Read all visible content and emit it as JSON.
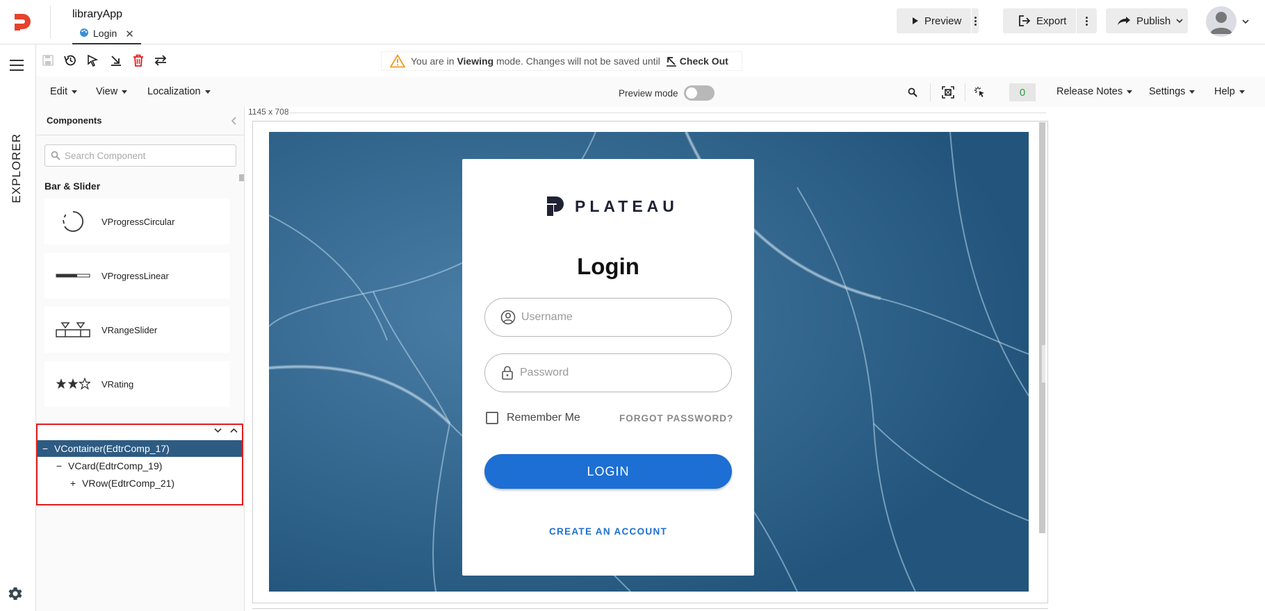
{
  "header": {
    "app_title": "libraryApp",
    "file_tab": {
      "label": "Login",
      "icon": "palette-icon"
    },
    "preview_label": "Preview",
    "export_label": "Export",
    "publish_label": "Publish"
  },
  "rail": {
    "explorer_label": "EXPLORER"
  },
  "banner": {
    "text_prefix": "You are in",
    "mode": "Viewing",
    "text_suffix": "mode. Changes will not be saved until",
    "checkout_label": "Check Out"
  },
  "menubar": {
    "edit": "Edit",
    "view": "View",
    "localization": "Localization",
    "preview_mode_label": "Preview mode",
    "preview_mode_on": false,
    "counter": "0",
    "release_notes": "Release Notes",
    "settings": "Settings",
    "help": "Help"
  },
  "components": {
    "title": "Components",
    "search_placeholder": "Search Component",
    "section": "Bar & Slider",
    "items": [
      {
        "label": "VProgressCircular",
        "icon": "progress-circular-icon"
      },
      {
        "label": "VProgressLinear",
        "icon": "progress-linear-icon"
      },
      {
        "label": "VRangeSlider",
        "icon": "range-slider-icon"
      },
      {
        "label": "VRating",
        "icon": "rating-icon"
      }
    ]
  },
  "tree": {
    "nodes": [
      {
        "toggle": "−",
        "label": "VContainer(EdtrComp_17)",
        "selected": true
      },
      {
        "toggle": "−",
        "label": "VCard(EdtrComp_19)",
        "selected": false
      },
      {
        "toggle": "+",
        "label": "VRow(EdtrComp_21)",
        "selected": false
      }
    ]
  },
  "canvas": {
    "size_label": "1145 x 708",
    "login": {
      "brand": "PLATEAU",
      "title": "Login",
      "username_placeholder": "Username",
      "password_placeholder": "Password",
      "remember_label": "Remember Me",
      "forgot_label": "FORGOT PASSWORD?",
      "login_button": "LOGIN",
      "create_account": "CREATE AN ACCOUNT"
    }
  },
  "colors": {
    "brand_red": "#e8412c",
    "selection_blue": "#2e5b82",
    "primary_button": "#1d6fd3",
    "counter_green": "#2e9e3e",
    "highlight_border": "#e31b1b",
    "background_blue": "#2b5f86"
  }
}
